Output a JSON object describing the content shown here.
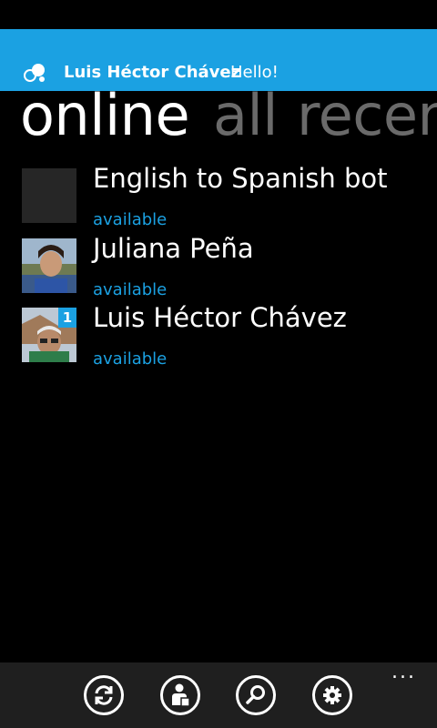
{
  "header": {
    "user_name": "Luis Héctor Chávez",
    "greeting": "Hello!",
    "logo_icon": "app-logo-icon"
  },
  "pivot": {
    "tabs": [
      {
        "label": "online",
        "active": true
      },
      {
        "label": "all",
        "active": false
      },
      {
        "label": "recen",
        "active": false
      }
    ]
  },
  "contacts": [
    {
      "name": "English to Spanish bot",
      "status": "available",
      "avatar": "blank"
    },
    {
      "name": "Juliana Peña",
      "status": "available",
      "avatar": "photo-woman"
    },
    {
      "name": "Luis Héctor Chávez",
      "status": "available",
      "avatar": "photo-man",
      "badge": "1"
    }
  ],
  "appbar": {
    "buttons": [
      {
        "name": "refresh",
        "icon": "refresh-icon"
      },
      {
        "name": "add-contact",
        "icon": "person-icon"
      },
      {
        "name": "search",
        "icon": "search-icon"
      },
      {
        "name": "settings",
        "icon": "gear-icon"
      }
    ],
    "more": "..."
  },
  "colors": {
    "accent": "#1ba1e2",
    "background": "#000000",
    "appbar": "#1f1f1f",
    "inactive_tab": "#6a6a6a"
  }
}
